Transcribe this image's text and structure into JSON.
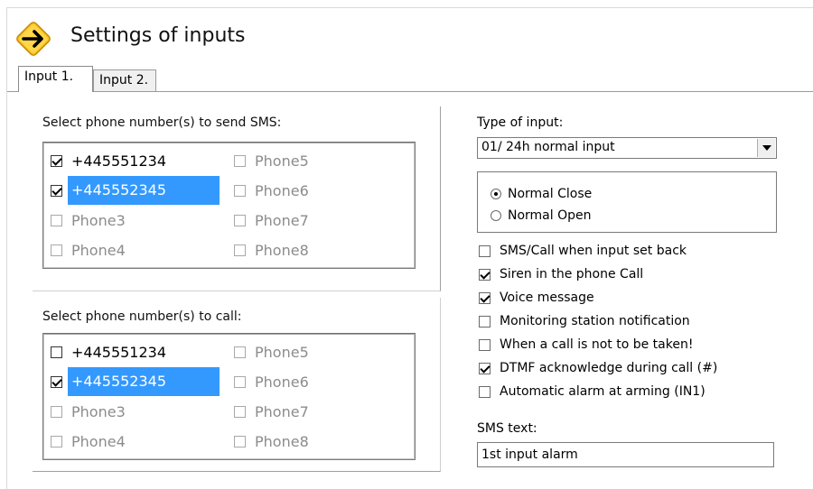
{
  "header": {
    "title": "Settings of inputs",
    "icon": "arrow-right-diamond-icon",
    "icon_color": "#f5b400"
  },
  "tabs": [
    {
      "label": "Input 1.",
      "active": true
    },
    {
      "label": "Input 2.",
      "active": false
    }
  ],
  "sms_group": {
    "label": "Select phone number(s) to send SMS:",
    "items": [
      {
        "label": "+445551234",
        "checked": true,
        "enabled": true,
        "selected": false
      },
      {
        "label": "+445552345",
        "checked": true,
        "enabled": true,
        "selected": true
      },
      {
        "label": "Phone3",
        "checked": false,
        "enabled": false,
        "selected": false
      },
      {
        "label": "Phone4",
        "checked": false,
        "enabled": false,
        "selected": false
      },
      {
        "label": "Phone5",
        "checked": false,
        "enabled": false,
        "selected": false
      },
      {
        "label": "Phone6",
        "checked": false,
        "enabled": false,
        "selected": false
      },
      {
        "label": "Phone7",
        "checked": false,
        "enabled": false,
        "selected": false
      },
      {
        "label": "Phone8",
        "checked": false,
        "enabled": false,
        "selected": false
      }
    ]
  },
  "call_group": {
    "label": "Select phone number(s) to call:",
    "items": [
      {
        "label": "+445551234",
        "checked": false,
        "enabled": true,
        "selected": false
      },
      {
        "label": "+445552345",
        "checked": true,
        "enabled": true,
        "selected": true
      },
      {
        "label": "Phone3",
        "checked": false,
        "enabled": false,
        "selected": false
      },
      {
        "label": "Phone4",
        "checked": false,
        "enabled": false,
        "selected": false
      },
      {
        "label": "Phone5",
        "checked": false,
        "enabled": false,
        "selected": false
      },
      {
        "label": "Phone6",
        "checked": false,
        "enabled": false,
        "selected": false
      },
      {
        "label": "Phone7",
        "checked": false,
        "enabled": false,
        "selected": false
      },
      {
        "label": "Phone8",
        "checked": false,
        "enabled": false,
        "selected": false
      }
    ]
  },
  "type_of_input": {
    "label": "Type of input:",
    "selected_value": "01/ 24h normal input"
  },
  "contact_mode": {
    "options": [
      {
        "label": "Normal Close",
        "selected": true
      },
      {
        "label": "Normal Open",
        "selected": false
      }
    ]
  },
  "options": [
    {
      "label": "SMS/Call when input set back",
      "checked": false
    },
    {
      "label": "Siren in the phone Call",
      "checked": true
    },
    {
      "label": "Voice message",
      "checked": true
    },
    {
      "label": "Monitoring station notification",
      "checked": false
    },
    {
      "label": "When a call is not to be taken!",
      "checked": false
    },
    {
      "label": "DTMF acknowledge during call (#)",
      "checked": true
    },
    {
      "label": "Automatic alarm at arming (IN1)",
      "checked": false
    }
  ],
  "sms_text": {
    "label": "SMS text:",
    "value": "1st input alarm"
  },
  "colors": {
    "selection": "#3399ff",
    "disabled_text": "#8c8c8c"
  }
}
